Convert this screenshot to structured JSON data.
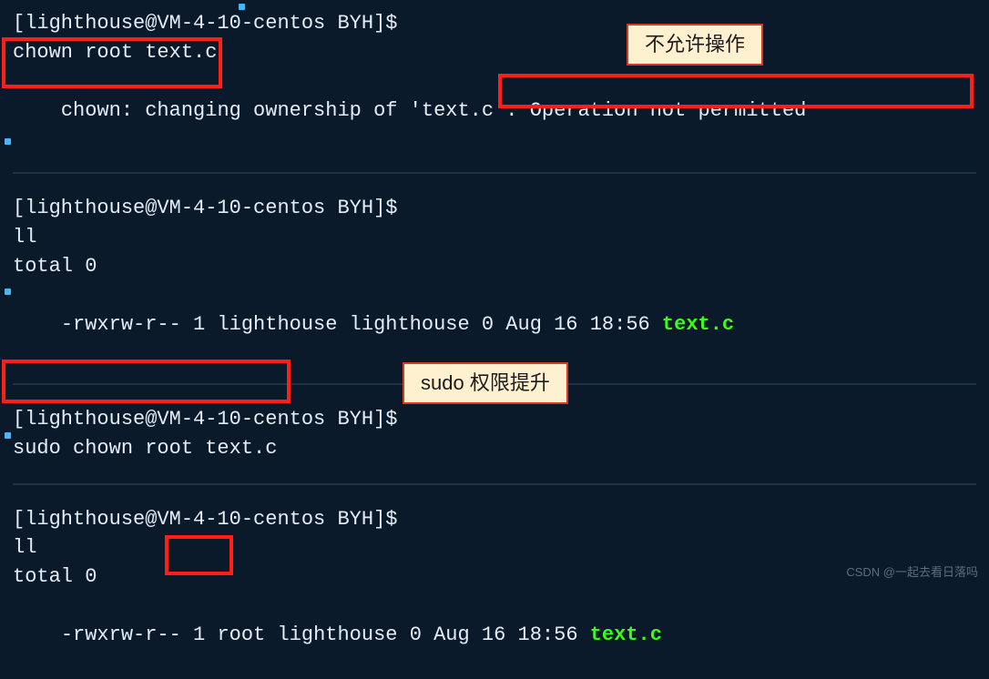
{
  "block1": {
    "prompt": "[lighthouse@VM-4-10-centos BYH]$",
    "cmd": "chown root text.c",
    "out_pre": "chown: changing ownership of 'text.c': ",
    "out_msg": "Operation not permitted",
    "label": "不允许操作"
  },
  "block2": {
    "prompt": "[lighthouse@VM-4-10-centos BYH]$",
    "cmd": "ll",
    "total": "total 0",
    "ls_pre": "-rwxrw-r-- 1 lighthouse lighthouse 0 Aug 16 18:56 ",
    "ls_file": "text.c"
  },
  "block3": {
    "prompt": "[lighthouse@VM-4-10-centos BYH]$",
    "cmd": "sudo chown root text.c",
    "label": "sudo 权限提升"
  },
  "block4": {
    "prompt": "[lighthouse@VM-4-10-centos BYH]$",
    "cmd": "ll",
    "total": "total 0",
    "ls_a": "-rwxrw-r-- 1 ",
    "ls_owner": "root",
    "ls_b": " lighthouse 0 Aug 16 18:56 ",
    "ls_file": "text.c"
  },
  "watermark": "CSDN @一起去看日落吗"
}
